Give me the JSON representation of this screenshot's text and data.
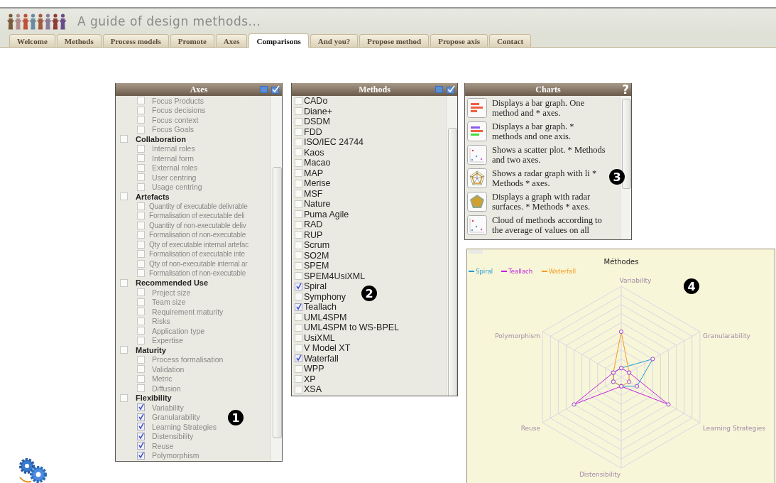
{
  "header": {
    "title": "A guide of design methods..."
  },
  "tabs": [
    {
      "label": "Welcome",
      "selected": false
    },
    {
      "label": "Methods",
      "selected": false
    },
    {
      "label": "Process models",
      "selected": false
    },
    {
      "label": "Promote",
      "selected": false
    },
    {
      "label": "Axes",
      "selected": false
    },
    {
      "label": "Comparisons",
      "selected": true
    },
    {
      "label": "And you?",
      "selected": false
    },
    {
      "label": "Propose method",
      "selected": false
    },
    {
      "label": "Propose axis",
      "selected": false
    },
    {
      "label": "Contact",
      "selected": false
    }
  ],
  "axes_panel": {
    "title": "Axes",
    "marker": "1",
    "groups": [
      {
        "children": [
          {
            "label": "Focus Products",
            "checked": false
          },
          {
            "label": "Focus decisions",
            "checked": false
          },
          {
            "label": "Focus context",
            "checked": false
          },
          {
            "label": "Focus Goals",
            "checked": false
          }
        ]
      },
      {
        "label": "Collaboration",
        "checked": false,
        "children": [
          {
            "label": "Internal roles",
            "checked": false
          },
          {
            "label": "Internal form",
            "checked": false
          },
          {
            "label": "External roles",
            "checked": false
          },
          {
            "label": "User centring",
            "checked": false
          },
          {
            "label": "Usage centring",
            "checked": false
          }
        ]
      },
      {
        "label": "Artefacts",
        "checked": false,
        "small": true,
        "children": [
          {
            "label": "Quantity of executable delivrable",
            "checked": false
          },
          {
            "label": "Formalisation of executable deli",
            "checked": false
          },
          {
            "label": "Quantity of non-executable deliv",
            "checked": false
          },
          {
            "label": "Formalisation of non-executable",
            "checked": false
          },
          {
            "label": "Qty of executable internal artefac",
            "checked": false
          },
          {
            "label": "Formalisation of executable inte",
            "checked": false
          },
          {
            "label": "Qty of non-executable internal ar",
            "checked": false
          },
          {
            "label": "Formalisation of non-executable",
            "checked": false
          }
        ]
      },
      {
        "label": "Recommended Use",
        "checked": false,
        "children": [
          {
            "label": "Project size",
            "checked": false
          },
          {
            "label": "Team size",
            "checked": false
          },
          {
            "label": "Requirement maturity",
            "checked": false
          },
          {
            "label": "Risks",
            "checked": false
          },
          {
            "label": "Application type",
            "checked": false
          },
          {
            "label": "Expertise",
            "checked": false
          }
        ]
      },
      {
        "label": "Maturity",
        "checked": false,
        "children": [
          {
            "label": "Process formalisation",
            "checked": false
          },
          {
            "label": "Validation",
            "checked": false
          },
          {
            "label": "Metric",
            "checked": false
          },
          {
            "label": "Diffusion",
            "checked": false
          }
        ]
      },
      {
        "label": "Flexibility",
        "checked": false,
        "children": [
          {
            "label": "Variability",
            "checked": true
          },
          {
            "label": "Granularability",
            "checked": true
          },
          {
            "label": "Learning Strategies",
            "checked": true
          },
          {
            "label": "Distensibility",
            "checked": true
          },
          {
            "label": "Reuse",
            "checked": true
          },
          {
            "label": "Polymorphism",
            "checked": true
          }
        ]
      }
    ]
  },
  "methods_panel": {
    "title": "Methods",
    "marker": "2",
    "items": [
      {
        "label": "CADo",
        "checked": false
      },
      {
        "label": "Diane+",
        "checked": false
      },
      {
        "label": "DSDM",
        "checked": false
      },
      {
        "label": "FDD",
        "checked": false
      },
      {
        "label": "ISO/IEC 24744",
        "checked": false
      },
      {
        "label": "Kaos",
        "checked": false
      },
      {
        "label": "Macao",
        "checked": false
      },
      {
        "label": "MAP",
        "checked": false
      },
      {
        "label": "Merise",
        "checked": false
      },
      {
        "label": "MSF",
        "checked": false
      },
      {
        "label": "Nature",
        "checked": false
      },
      {
        "label": "Puma Agile",
        "checked": false
      },
      {
        "label": "RAD",
        "checked": false
      },
      {
        "label": "RUP",
        "checked": false
      },
      {
        "label": "Scrum",
        "checked": false
      },
      {
        "label": "SO2M",
        "checked": false
      },
      {
        "label": "SPEM",
        "checked": false
      },
      {
        "label": "SPEM4UsiXML",
        "checked": false
      },
      {
        "label": "Spiral",
        "checked": true
      },
      {
        "label": "Symphony",
        "checked": false
      },
      {
        "label": "Teallach",
        "checked": true
      },
      {
        "label": "UML4SPM",
        "checked": false
      },
      {
        "label": "UML4SPM to WS-BPEL",
        "checked": false
      },
      {
        "label": "UsiXML",
        "checked": false
      },
      {
        "label": "V Model XT",
        "checked": false
      },
      {
        "label": "Waterfall",
        "checked": true
      },
      {
        "label": "WPP",
        "checked": false
      },
      {
        "label": "XP",
        "checked": false
      },
      {
        "label": "XSA",
        "checked": false
      }
    ]
  },
  "charts_panel": {
    "title": "Charts",
    "help": "?",
    "marker": "3",
    "items": [
      {
        "kind": "bars",
        "text": "Displays a bar graph. One method and * axes."
      },
      {
        "kind": "multibars",
        "text": "Displays a bar graph. * methods and one axis."
      },
      {
        "kind": "scatter",
        "text": "Shows a scatter plot. * Methods and two axes."
      },
      {
        "kind": "radar",
        "text": "Shows a radar graph with li * Methods * axes."
      },
      {
        "kind": "surface",
        "text": "Displays a graph with radar surfaces. * Methods * axes."
      },
      {
        "kind": "scatter",
        "text": "Cloud of methods according to the average of values on all"
      }
    ]
  },
  "radar_chart": {
    "title": "Méthodes",
    "marker": "4",
    "legend": [
      {
        "name": "Spiral",
        "color": "#1f9ad6"
      },
      {
        "name": "Teallach",
        "color": "#c21ee0"
      },
      {
        "name": "Waterfall",
        "color": "#f59a23"
      }
    ],
    "axis_labels": [
      "Variability",
      "Granularability",
      "Learning Strategies",
      "Distensibility",
      "Reuse",
      "Polymorphism"
    ]
  }
}
